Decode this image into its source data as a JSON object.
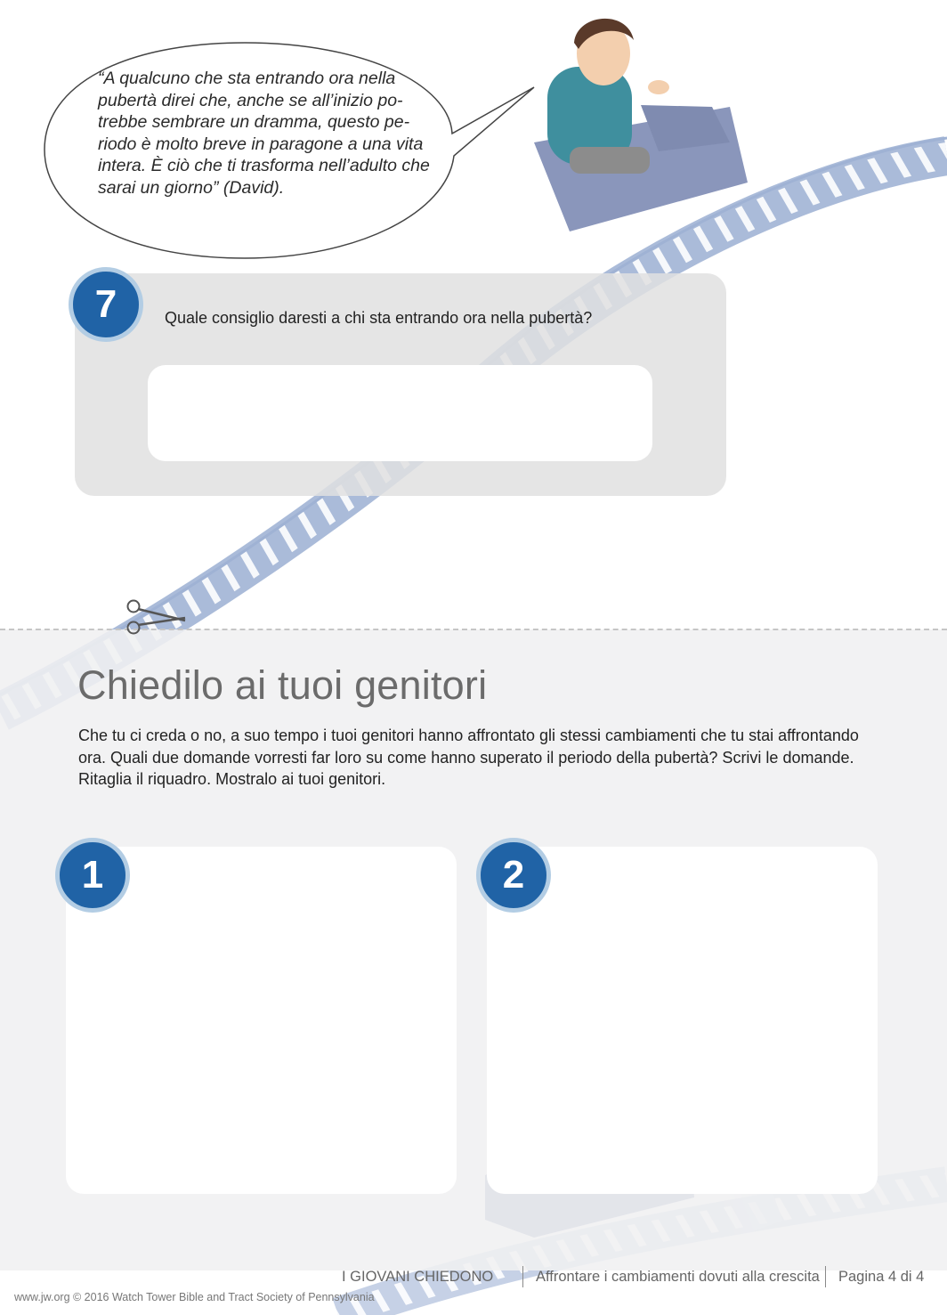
{
  "quote": {
    "text": "“A qualcuno che sta entrando ora nella pubertà direi che, anche se all’inizio po-trebbe sembrare un dramma, questo pe-riodo è molto breve in paragone a una vita intera. È ciò che ti trasforma nell’adulto che sarai un giorno” (David)."
  },
  "question7": {
    "number": "7",
    "text": "Quale consiglio daresti a chi sta entrando ora nella pubertà?"
  },
  "ask_parents": {
    "title": "Chiedilo ai tuoi genitori",
    "body": "Che tu ci creda o no, a suo tempo i tuoi genitori hanno affrontato gli stessi cambiamenti che tu stai affrontando ora. Quali due domande vorresti far loro su come hanno superato il periodo della pubertà? Scrivi le domande. Ritaglia il riquadro. Mostralo ai tuoi genitori.",
    "boxes": [
      {
        "number": "1"
      },
      {
        "number": "2"
      }
    ]
  },
  "footer": {
    "series": "I GIOVANI CHIEDONO",
    "article": "Affrontare i cambiamenti dovuti alla crescita",
    "page": "Pagina 4 di 4",
    "copyright": "www.jw.org © 2016 Watch Tower Bible and Tract Society of Pennsylvania"
  },
  "colors": {
    "badge_blue": "#2063a6",
    "badge_ring": "#b3cde4",
    "track": "#a9bbdb",
    "panel_gray": "#e1e1e1",
    "title_gray": "#6b6b6b"
  },
  "icons": [
    "scissors-icon",
    "speech-bubble",
    "roller-coaster-illustration"
  ]
}
